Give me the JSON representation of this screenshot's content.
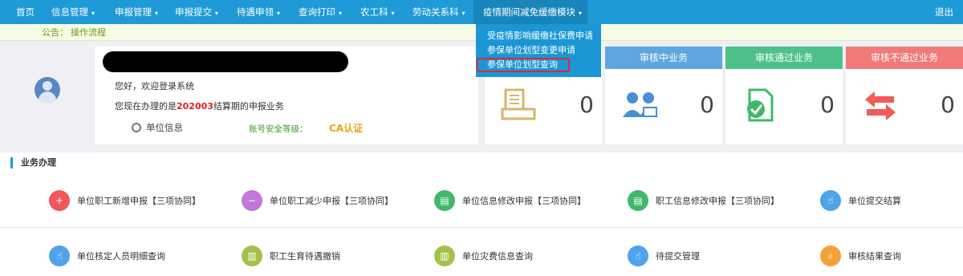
{
  "nav": {
    "items": [
      {
        "label": "首页",
        "caret": ""
      },
      {
        "label": "信息管理",
        "caret": "▾"
      },
      {
        "label": "申报管理",
        "caret": "▾"
      },
      {
        "label": "申报提交",
        "caret": "▾"
      },
      {
        "label": "待遇申领",
        "caret": "▾"
      },
      {
        "label": "查询打印",
        "caret": "▾"
      },
      {
        "label": "农工科",
        "caret": "▾"
      },
      {
        "label": "劳动关系科",
        "caret": "▾"
      },
      {
        "label": "疫情期间减免缓缴模块",
        "caret": "▾"
      }
    ],
    "logout": "退出"
  },
  "dropdown": {
    "items": [
      "受疫情影响缓缴社保费申请",
      "参保单位划型变更申请",
      "参保单位划型查询"
    ]
  },
  "notice": {
    "label": "公告：",
    "link": "操作流程"
  },
  "profile": {
    "welcome": "您好，欢迎登录系统",
    "period_prefix": "您现在办理的是",
    "period_value": "202003",
    "period_suffix": "结算期的申报业务",
    "unit_info": "单位信息",
    "security_label": "账号安全等级：",
    "security_value": "CA认证"
  },
  "stats": [
    {
      "title": "",
      "count": "0",
      "color": "#ffffff",
      "icon": "document-printer-icon"
    },
    {
      "title": "审核中业务",
      "count": "0",
      "color": "#5fa6e0",
      "icon": "users-reviewing-icon"
    },
    {
      "title": "审核通过业务",
      "count": "0",
      "color": "#4cc28a",
      "icon": "approved-check-icon"
    },
    {
      "title": "审核不通过业务",
      "count": "0",
      "color": "#f07a78",
      "icon": "transfer-arrows-icon"
    }
  ],
  "business": {
    "title": "业务办理",
    "row1": [
      {
        "label": "单位职工新增申报【三项协同】",
        "icon": "add-user-icon",
        "color": "#f0575a",
        "glyph": "+"
      },
      {
        "label": "单位职工减少申报【三项协同】",
        "icon": "remove-user-icon",
        "color": "#c377d8",
        "glyph": "−"
      },
      {
        "label": "单位信息修改申报【三项协同】",
        "icon": "unit-card-icon",
        "color": "#3fb86a",
        "glyph": "▤"
      },
      {
        "label": "职工信息修改申报【三项协同】",
        "icon": "staff-card-icon",
        "color": "#3fb86a",
        "glyph": "▤"
      },
      {
        "label": "单位提交结算",
        "icon": "submit-settle-icon",
        "color": "#4ea3ea",
        "glyph": "☝"
      }
    ],
    "row2": [
      {
        "label": "单位核定人员明细查询",
        "icon": "staff-detail-icon",
        "color": "#4ea3ea",
        "glyph": "☝"
      },
      {
        "label": "职工生育待遇撤销",
        "icon": "maternity-cancel-icon",
        "color": "#a3c14a",
        "glyph": "▥"
      },
      {
        "label": "单位灾费信息查询",
        "icon": "unit-fee-icon",
        "color": "#a3c14a",
        "glyph": "▥"
      },
      {
        "label": "待提交管理",
        "icon": "pending-submit-icon",
        "color": "#4ea3ea",
        "glyph": "☝"
      },
      {
        "label": "审核结果查询",
        "icon": "search-result-icon",
        "color": "#f5a23c",
        "glyph": "⌕"
      }
    ]
  }
}
